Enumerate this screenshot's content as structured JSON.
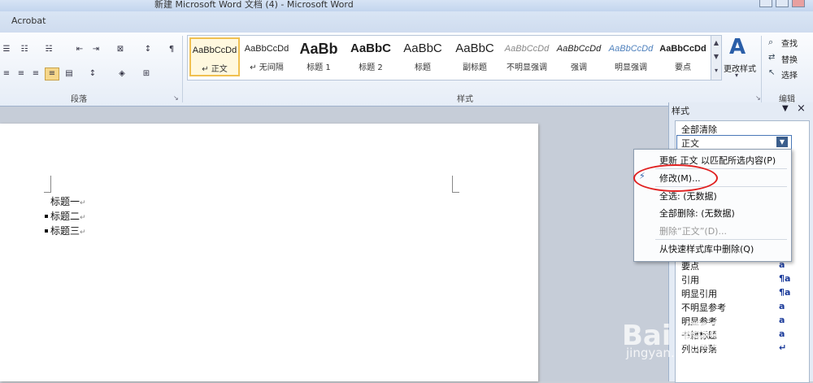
{
  "window": {
    "title": "新建 Microsoft Word 文档 (4) - Microsoft Word"
  },
  "ribbon": {
    "tab": "Acrobat",
    "groups": {
      "paragraph": "段落",
      "styles": "样式",
      "editing": "编辑"
    },
    "styles": [
      {
        "sample": "AaBbCcDd",
        "name": "↵ 正文"
      },
      {
        "sample": "AaBbCcDd",
        "name": "↵ 无间隔"
      },
      {
        "sample": "AaBb",
        "name": "标题 1"
      },
      {
        "sample": "AaBbC",
        "name": "标题 2"
      },
      {
        "sample": "AaBbC",
        "name": "标题"
      },
      {
        "sample": "AaBbC",
        "name": "副标题"
      },
      {
        "sample": "AaBbCcDd",
        "name": "不明显强调"
      },
      {
        "sample": "AaBbCcDd",
        "name": "强调"
      },
      {
        "sample": "AaBbCcDd",
        "name": "明显强调"
      },
      {
        "sample": "AaBbCcDd",
        "name": "要点"
      }
    ],
    "change_styles": "更改样式",
    "edit": {
      "find": "查找",
      "replace": "替换",
      "select": "选择"
    }
  },
  "document": {
    "lines": [
      "标题一",
      "标题二",
      "标题三"
    ]
  },
  "styles_pane": {
    "title": "样式",
    "clear_all": "全部清除",
    "current": "正文",
    "items": [
      {
        "name": "要点",
        "mark": "a"
      },
      {
        "name": "引用",
        "mark": "¶a"
      },
      {
        "name": "明显引用",
        "mark": "¶a"
      },
      {
        "name": "不明显参考",
        "mark": "a"
      },
      {
        "name": "明显参考",
        "mark": "a"
      },
      {
        "name": "书籍标题",
        "mark": "a"
      },
      {
        "name": "列出段落",
        "mark": "↵"
      }
    ]
  },
  "context_menu": {
    "items": [
      "更新 正文 以匹配所选内容(P)",
      "修改(M)...",
      "全选: (无数据)",
      "全部删除: (无数据)",
      "删除“正文”(D)...",
      "从快速样式库中删除(Q)"
    ]
  },
  "watermark": {
    "brand": "Bai 经验",
    "url": "jingyan.baidu.com"
  }
}
